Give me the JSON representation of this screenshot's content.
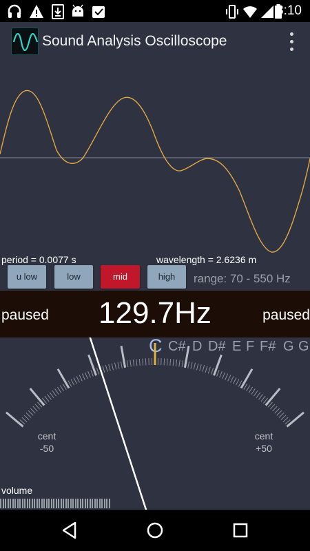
{
  "status_bar": {
    "time": "8:10",
    "left_icons": [
      "headphones-icon",
      "warning-icon",
      "download-icon",
      "android-icon",
      "clipboard-check-icon"
    ],
    "right_icons": [
      "vibrate-icon",
      "wifi-icon",
      "signal-icon",
      "battery-icon"
    ]
  },
  "app_bar": {
    "title": "Sound Analysis Oscilloscope",
    "logo_icon": "sine-wave-logo",
    "menu_icon": "overflow-menu-icon"
  },
  "readouts": {
    "period": "period = 0.0077 s",
    "wavelength": "wavelength = 2.6236 m"
  },
  "range_buttons": [
    {
      "label": "u low",
      "active": false
    },
    {
      "label": "low",
      "active": false
    },
    {
      "label": "mid",
      "active": true
    },
    {
      "label": "high",
      "active": false
    }
  ],
  "range_text": "range: 70 - 550 Hz",
  "frequency": {
    "left_status": "paused",
    "value": "129.7Hz",
    "right_status": "paused"
  },
  "tuner": {
    "current_note": "C",
    "notes": [
      "C",
      "C#",
      "D",
      "D#",
      "E",
      "F",
      "F#",
      "G",
      "G"
    ],
    "cent_left": [
      "cent",
      "-50"
    ],
    "cent_right": [
      "cent",
      "+50"
    ],
    "needle_cents": -18
  },
  "volume": {
    "label": "volume",
    "level": 0.36
  },
  "nav_bar": {
    "buttons": [
      "back-icon",
      "home-icon",
      "recents-icon"
    ]
  },
  "colors": {
    "background": "#2f3240",
    "waveform": "#e0a844",
    "active_button": "#c0172a",
    "button": "#8fa6bb",
    "frequency_band": "#1c0d07",
    "center_tick": "#e0b040"
  }
}
